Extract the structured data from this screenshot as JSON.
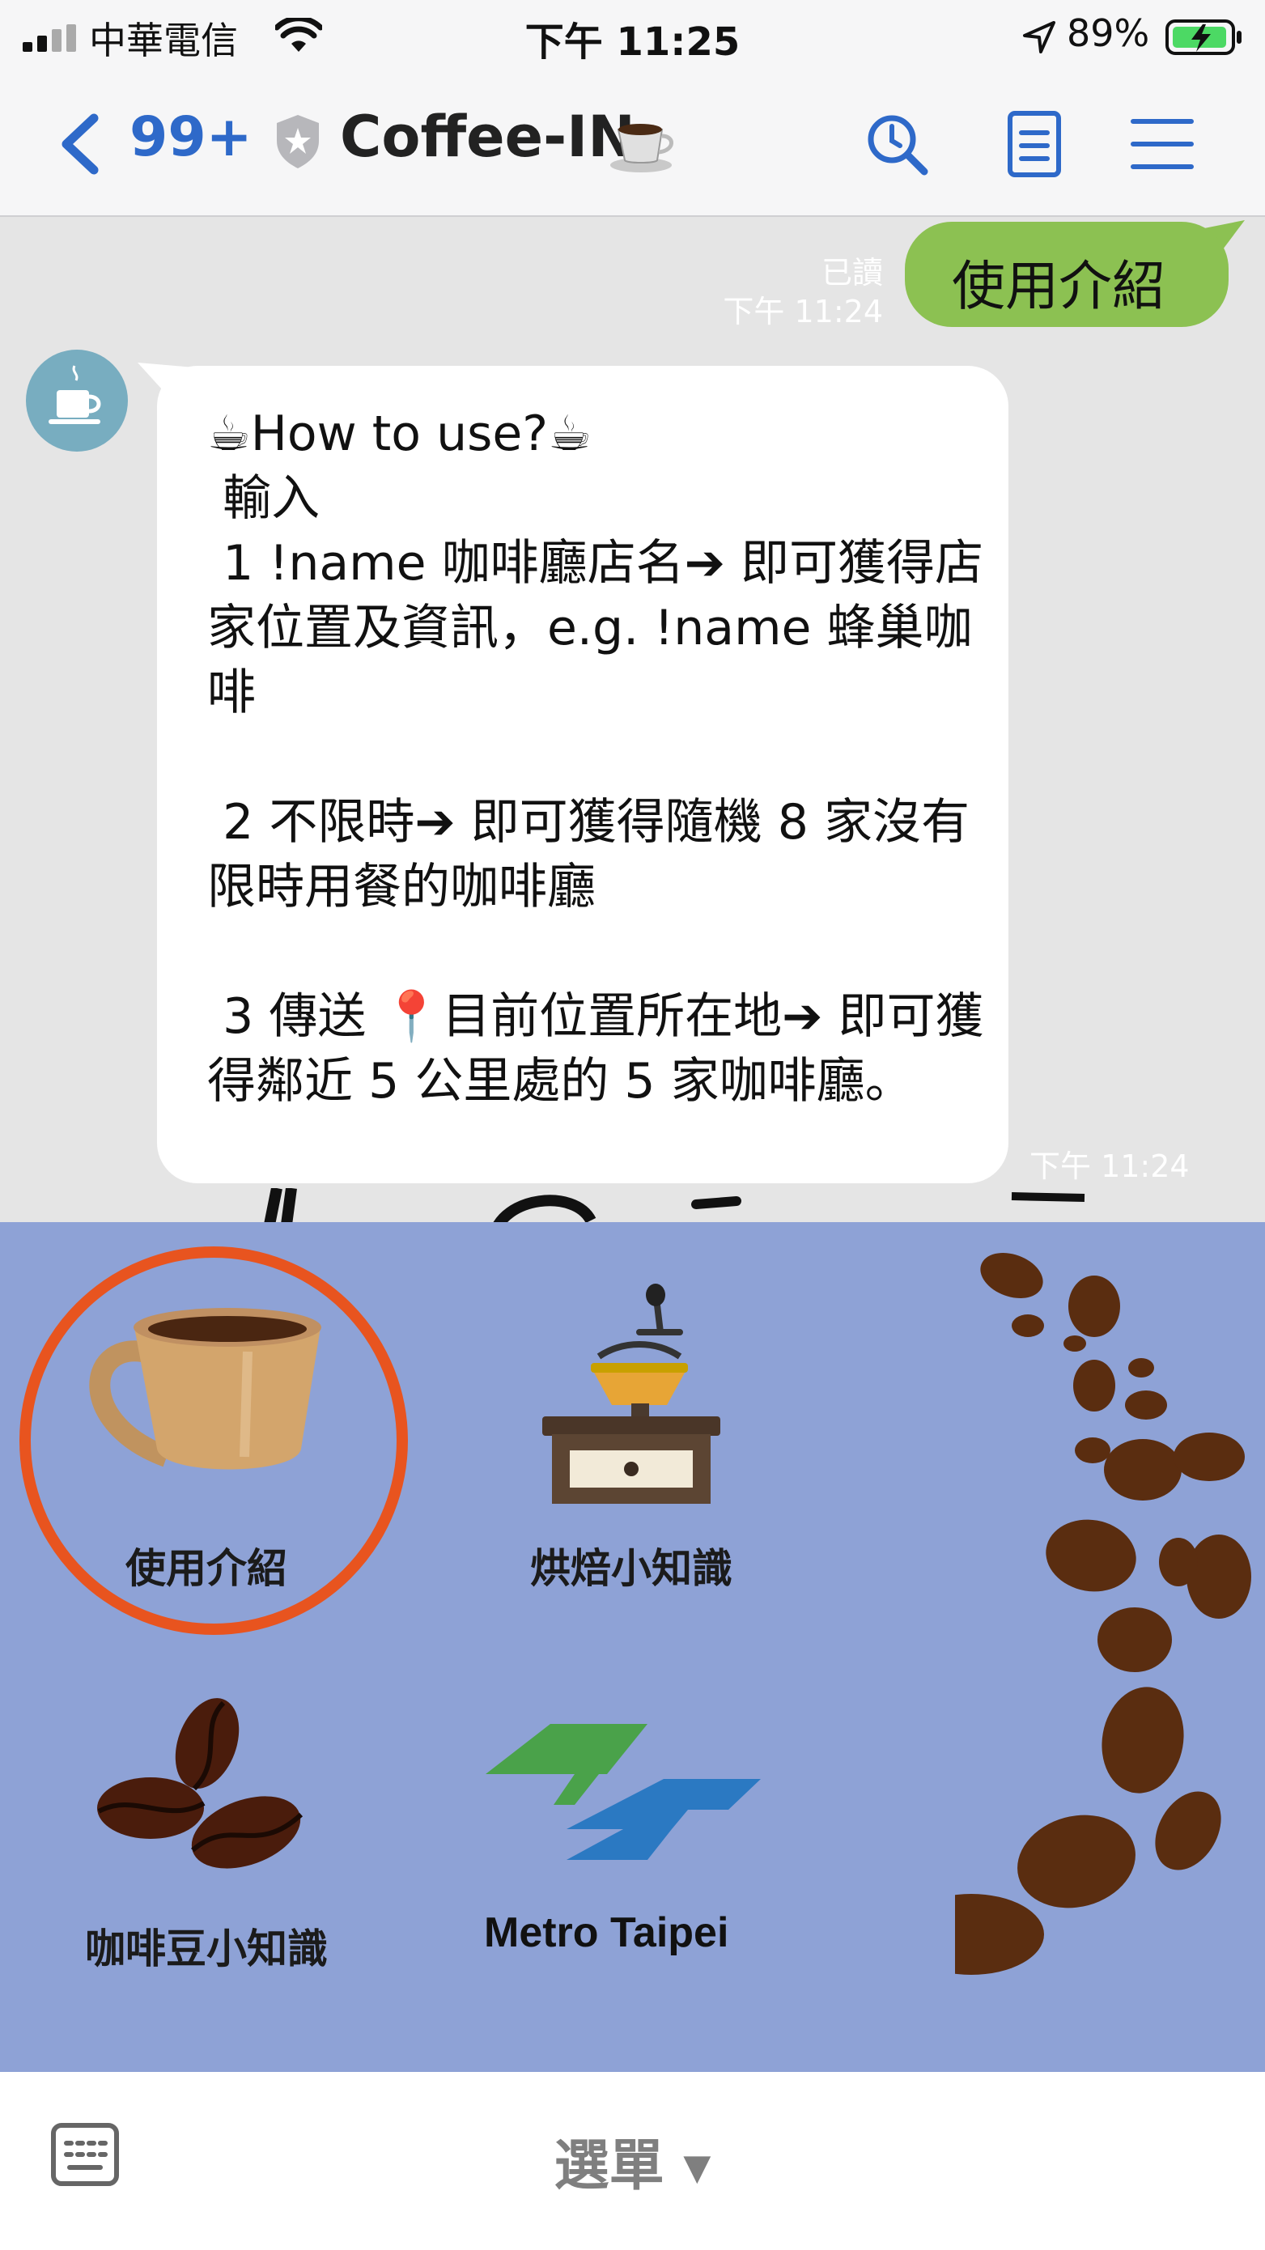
{
  "status_bar": {
    "carrier": "中華電信",
    "time": "下午 11:25",
    "battery": "89%"
  },
  "header": {
    "unread_count": "99+",
    "title": "Coffee-IN"
  },
  "chat": {
    "sent": {
      "text": "使用介紹",
      "read_status": "已讀",
      "time": "下午 11:24"
    },
    "received": {
      "text": "☕How to use?☕\n 輸入\n 1 !name 咖啡廳店名➔ 即可獲得店家位置及資訊，e.g. !name 蜂巢咖啡\n\n 2 不限時➔ 即可獲得隨機 8 家沒有限時用餐的咖啡廳\n\n 3 傳送 📍目前位置所在地➔ 即可獲得鄰近 5 公里處的 5 家咖啡廳。",
      "time": "下午 11:24"
    }
  },
  "rich_menu": {
    "items": [
      {
        "label": "使用介紹",
        "icon": "coffee-cup-icon"
      },
      {
        "label": "烘焙小知識",
        "icon": "coffee-grinder-icon"
      },
      {
        "label": "咖啡豆小知識",
        "icon": "coffee-beans-icon"
      },
      {
        "label": "Metro Taipei",
        "icon": "metro-taipei-logo"
      }
    ],
    "highlight_color": "#e8541f",
    "background": "#8ea2d6"
  },
  "bottom_bar": {
    "menu_label": "選單 ▾"
  },
  "colors": {
    "accent": "#2e69c9",
    "sent_bubble": "#8cc152"
  }
}
